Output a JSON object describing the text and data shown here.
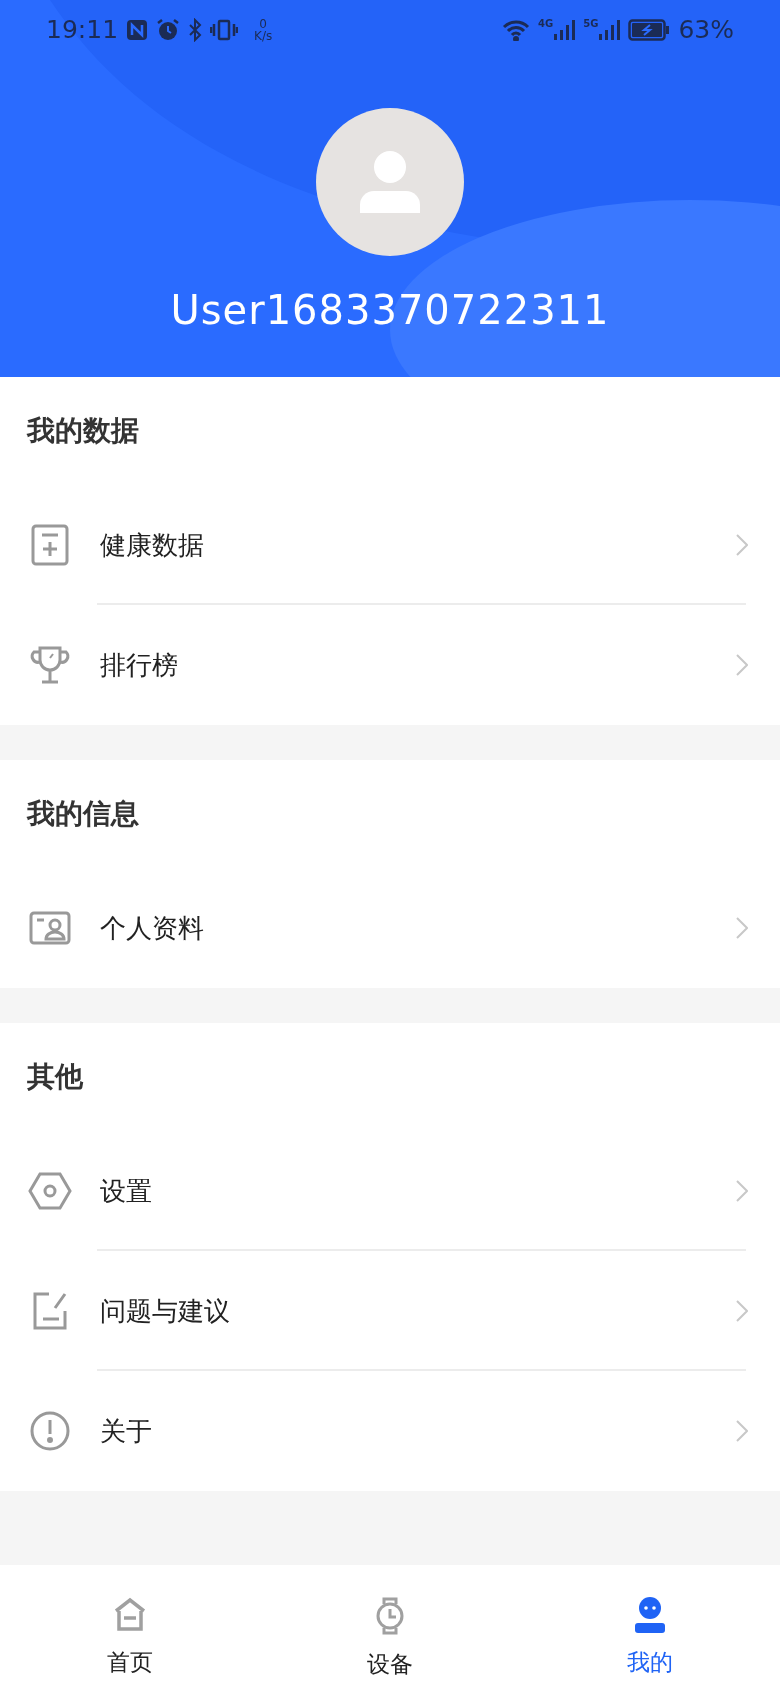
{
  "status_bar": {
    "time": "19:11",
    "net_speed_value": "0",
    "net_speed_unit": "K/s",
    "network_1": "4G",
    "network_2": "5G",
    "battery": "63%"
  },
  "profile": {
    "username": "User1683370722311"
  },
  "sections": [
    {
      "title": "我的数据",
      "items": [
        {
          "kind": "health",
          "label": "健康数据"
        },
        {
          "kind": "ranking",
          "label": "排行榜"
        }
      ]
    },
    {
      "title": "我的信息",
      "items": [
        {
          "kind": "profile",
          "label": "个人资料"
        }
      ]
    },
    {
      "title": "其他",
      "items": [
        {
          "kind": "settings",
          "label": "设置"
        },
        {
          "kind": "feedback",
          "label": "问题与建议"
        },
        {
          "kind": "about",
          "label": "关于"
        }
      ]
    }
  ],
  "bottom_nav": [
    {
      "kind": "home",
      "label": "首页",
      "selected": false
    },
    {
      "kind": "device",
      "label": "设备",
      "selected": false
    },
    {
      "kind": "me",
      "label": "我的",
      "selected": true
    }
  ]
}
